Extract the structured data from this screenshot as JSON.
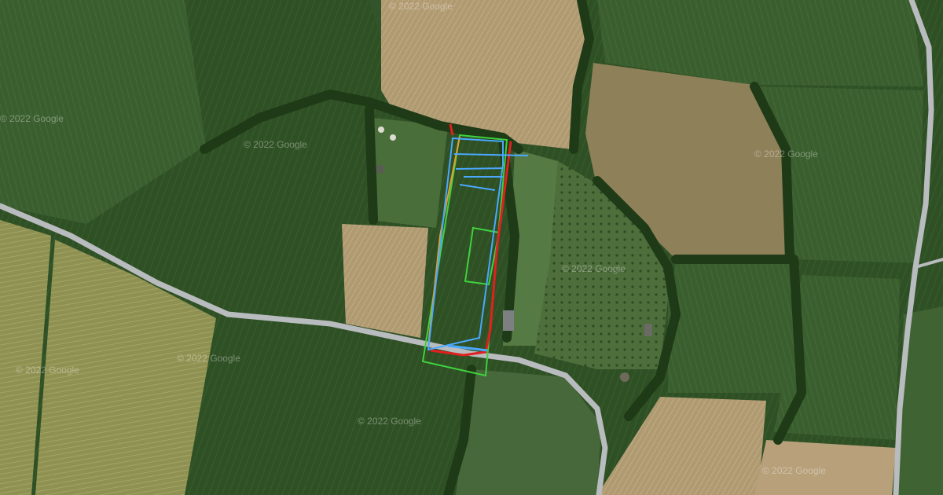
{
  "map": {
    "type": "satellite",
    "watermarks": [
      "© 2022 Google",
      "© 2022 Google",
      "© 2022 Google",
      "© 2022 Google",
      "© 2022 Google",
      "© 2022 Google",
      "© 2022 Google",
      "© 2022 Google",
      "© 2022 Google"
    ],
    "colors": {
      "field_dark": "#2f4f25",
      "field_mid": "#3d6330",
      "field_light": "#4f7440",
      "field_tan": "#b8a27a",
      "field_wheat": "#9a9a58",
      "hedge": "#1e3a16",
      "road": "#b9bcbe",
      "boundary_red": "#e02020",
      "boundary_blue": "#4aa8ff",
      "boundary_green": "#3fd23f",
      "boundary_orange": "#e0a030"
    }
  }
}
